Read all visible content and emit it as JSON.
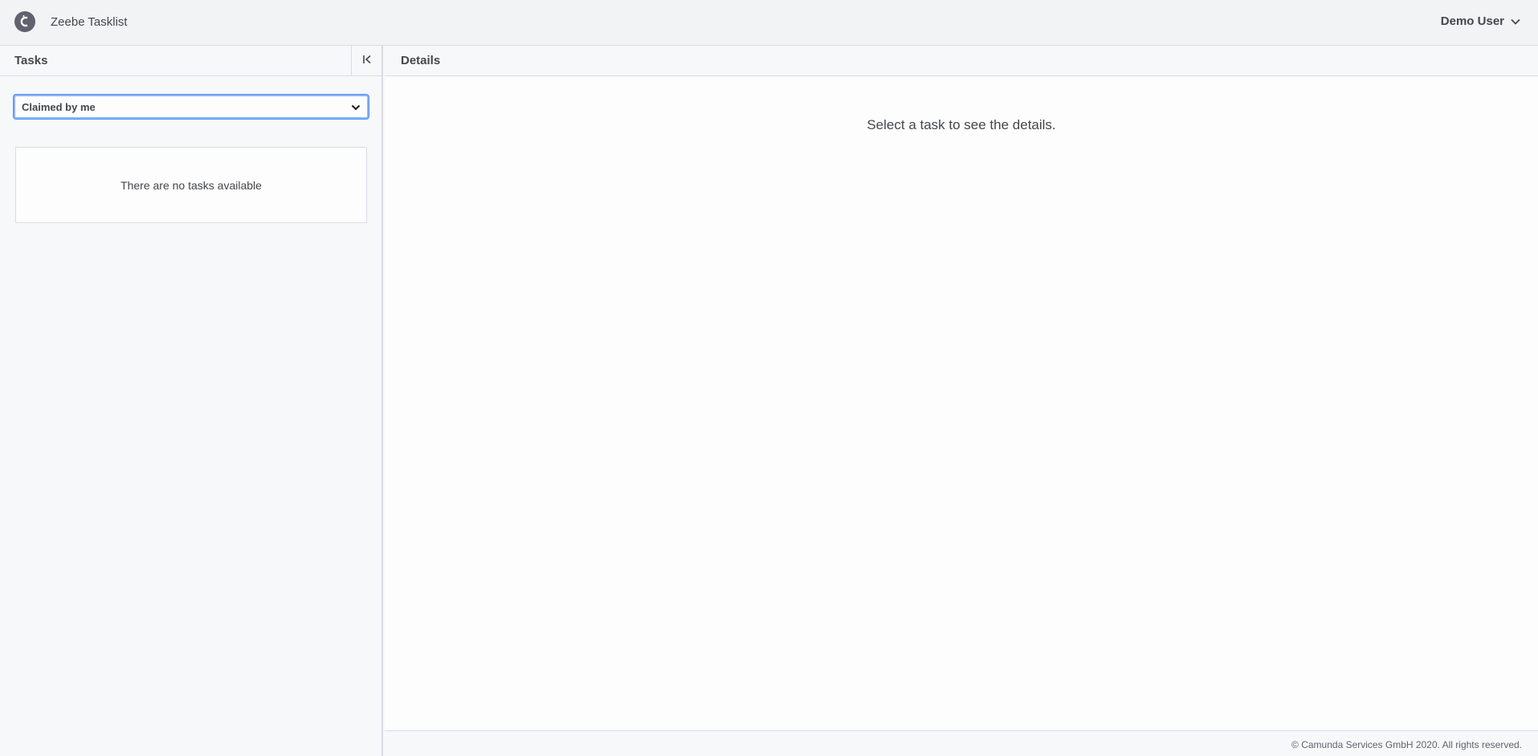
{
  "header": {
    "logo_icon": "camunda-logo-icon",
    "app_title": "Zeebe Tasklist",
    "user_name": "Demo User"
  },
  "tasks_panel": {
    "title": "Tasks",
    "filter_selected": "Claimed by me",
    "empty_message": "There are no tasks available"
  },
  "details_panel": {
    "title": "Details",
    "placeholder": "Select a task to see the details."
  },
  "footer": {
    "copyright": "© Camunda Services GmbH 2020. All rights reserved."
  },
  "colors": {
    "text": "#45464e",
    "border": "#d8dce3",
    "focus": "#4d90fe"
  }
}
